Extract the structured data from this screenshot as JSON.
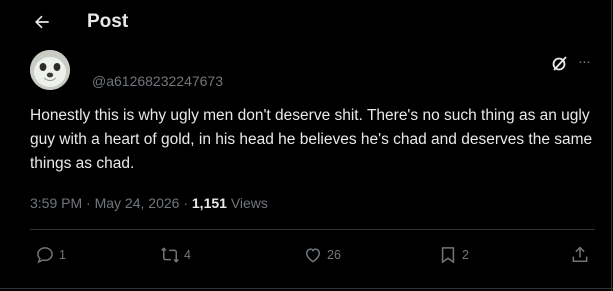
{
  "header": {
    "title": "Post"
  },
  "post": {
    "handle": "@a61268232247673",
    "text": "Honestly this is why ugly men don't deserve shit. There's no such thing as an ugly guy with a heart of gold, in his head he believes he's chad and deserves the same things as chad.",
    "time": "3:59 PM",
    "separator": "·",
    "date": "May 24, 2026",
    "views_count": "1,151",
    "views_label": "Views",
    "more_glyph": "···"
  },
  "actions": {
    "replies": "1",
    "reposts": "4",
    "likes": "26",
    "bookmarks": "2"
  },
  "icons": [
    "back-arrow-icon",
    "grok-icon",
    "more-icon",
    "reply-icon",
    "repost-icon",
    "like-icon",
    "bookmark-icon",
    "share-icon"
  ],
  "colors": {
    "background": "#000000",
    "text": "#e7e9ea",
    "muted": "#71767b",
    "border": "#2f3336"
  }
}
